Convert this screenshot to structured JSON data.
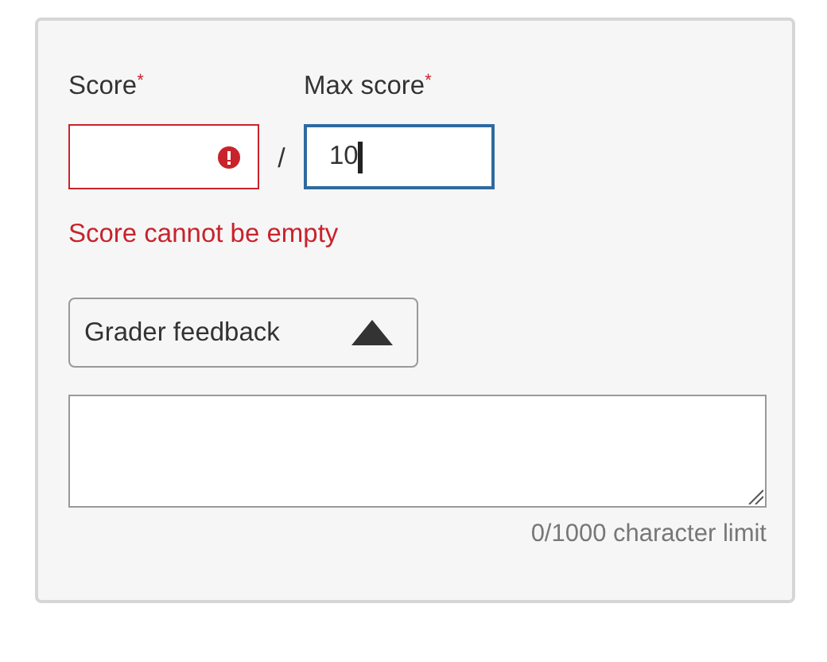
{
  "fields": [
    {
      "label": "Score",
      "required_mark": "*",
      "invalid": true,
      "focused": false
    },
    {
      "label": "Max score",
      "required_mark": "*",
      "value": "10",
      "invalid": false,
      "focused": true
    }
  ],
  "separator": "/",
  "error_message": "Score cannot be empty",
  "feedback": {
    "label": "Grader feedback",
    "expanded": true,
    "counter": "0/1000 character limit"
  }
}
